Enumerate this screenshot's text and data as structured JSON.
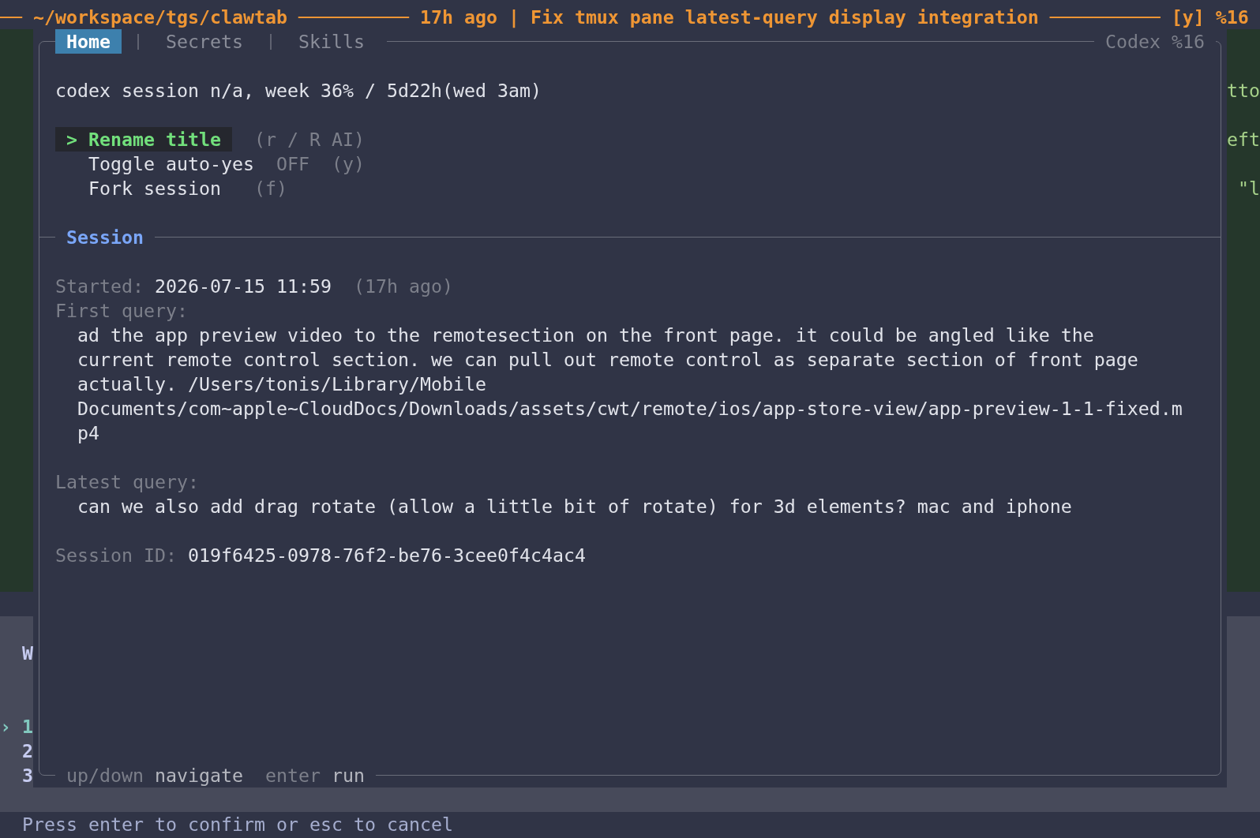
{
  "title_bar": {
    "text": "── ~/workspace/tgs/clawtab ────────── 17h ago | Fix tmux pane latest-query display integration ────────── [y] %16"
  },
  "background_pane": {
    "right_edge_lines": [
      "tto",
      "eft",
      "\"l"
    ],
    "left_edge": {
      "heading": "W",
      "marker": "›",
      "items": [
        {
          "label": "1",
          "selected": true
        },
        {
          "label": "2",
          "selected": false
        },
        {
          "label": "3",
          "selected": false
        }
      ]
    }
  },
  "popup": {
    "tabs": [
      {
        "label": "Home",
        "selected": true
      },
      {
        "label": "Secrets",
        "selected": false
      },
      {
        "label": "Skills",
        "selected": false
      }
    ],
    "pane_label": "Codex %16",
    "usage_summary": "codex session n/a, week 36% / 5d22h(wed 3am)",
    "actions": {
      "marker": ">",
      "items": [
        {
          "label": "Rename title",
          "hint": "(r / R AI)",
          "selected": true
        },
        {
          "label": "Toggle auto-yes",
          "value": "OFF",
          "hint": "(y)",
          "selected": false
        },
        {
          "label": "Fork session",
          "hint": "(f)",
          "selected": false
        }
      ]
    },
    "session": {
      "title": "Session",
      "started": {
        "label": "Started:",
        "value": "2026-07-15 11:59",
        "note": "(17h ago)"
      },
      "first_query": {
        "label": "First query:",
        "text": "ad the app preview video to the remotesection on the front page. it could be angled like the current remote control section. we can pull out remote control as separate section of front page actually. /Users/tonis/Library/Mobile Documents/com~apple~CloudDocs/Downloads/assets/cwt/remote/ios/app-store-view/app-preview-1-1-fixed.mp4"
      },
      "latest_query": {
        "label": "Latest query:",
        "text": "can we also add drag rotate (allow a little bit of rotate) for 3d elements? mac and iphone"
      },
      "session_id": {
        "label": "Session ID:",
        "value": "019f6425-0978-76f2-be76-3cee0f4c4ac4"
      }
    },
    "footer_hints": [
      {
        "key": "up/down",
        "action": "navigate"
      },
      {
        "key": "enter",
        "action": "run"
      }
    ]
  },
  "prompt": "Press enter to confirm or esc to cancel"
}
